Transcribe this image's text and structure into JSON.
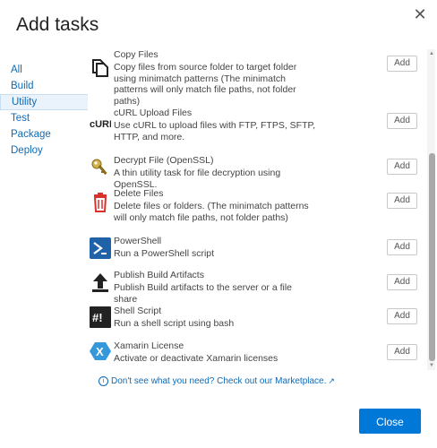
{
  "dialog": {
    "title": "Add tasks",
    "close_symbol": "✕"
  },
  "sidebar": {
    "items": [
      {
        "label": "All",
        "active": false
      },
      {
        "label": "Build",
        "active": false
      },
      {
        "label": "Utility",
        "active": true
      },
      {
        "label": "Test",
        "active": false
      },
      {
        "label": "Package",
        "active": false
      },
      {
        "label": "Deploy",
        "active": false
      }
    ]
  },
  "tasks": [
    {
      "name": "Copy Files",
      "description": "Copy files from source folder to target folder using minimatch patterns (The minimatch patterns will only match file paths, not folder paths)",
      "add_label": "Add",
      "icon": "copy-files-icon"
    },
    {
      "name": "cURL Upload Files",
      "description": "Use cURL to upload files with FTP, FTPS, SFTP, HTTP, and more.",
      "add_label": "Add",
      "icon": "curl-icon",
      "icon_text": "cURL"
    },
    {
      "name": "Decrypt File (OpenSSL)",
      "description": "A thin utility task for file decryption using OpenSSL.",
      "add_label": "Add",
      "icon": "decrypt-key-icon"
    },
    {
      "name": "Delete Files",
      "description": "Delete files or folders. (The minimatch patterns will only match file paths, not folder paths)",
      "add_label": "Add",
      "icon": "trash-icon"
    },
    {
      "name": "PowerShell",
      "description": "Run a PowerShell script",
      "add_label": "Add",
      "icon": "powershell-icon"
    },
    {
      "name": "Publish Build Artifacts",
      "description": "Publish Build artifacts to the server or a file share",
      "add_label": "Add",
      "icon": "upload-arrow-icon"
    },
    {
      "name": "Shell Script",
      "description": "Run a shell script using bash",
      "add_label": "Add",
      "icon": "shell-script-icon",
      "icon_text": "#!"
    },
    {
      "name": "Xamarin License",
      "description": "Activate or deactivate Xamarin licenses",
      "add_label": "Add",
      "icon": "xamarin-icon",
      "icon_text": "X"
    }
  ],
  "marketplace_link": {
    "info_symbol": "i",
    "label": "Don't see what you need? Check out our Marketplace.",
    "external_symbol": "↗"
  },
  "footer": {
    "close_label": "Close"
  },
  "colors": {
    "accent": "#0078d7",
    "link": "#0f6ab4",
    "active_bg": "#eaf3fb",
    "scrollbar": "#a9a9a9"
  }
}
